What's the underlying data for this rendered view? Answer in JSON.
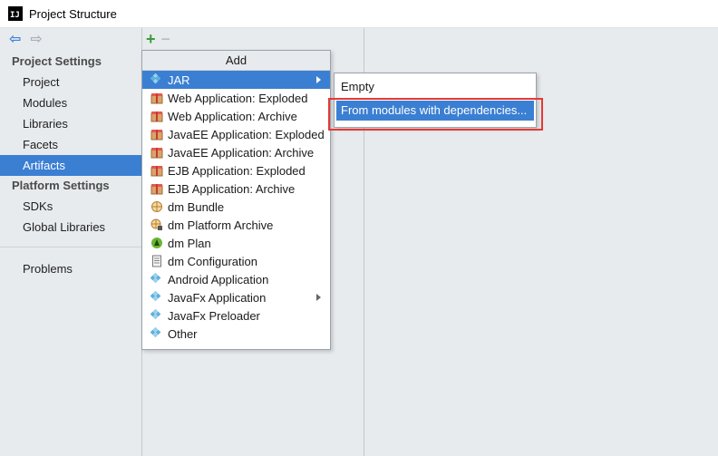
{
  "window": {
    "title": "Project Structure",
    "app_icon_text": "IJ"
  },
  "nav": {
    "back_icon": "arrow-left-icon",
    "forward_icon": "arrow-right-icon"
  },
  "sidebar": {
    "project_settings": {
      "label": "Project Settings",
      "items": [
        "Project",
        "Modules",
        "Libraries",
        "Facets",
        "Artifacts"
      ],
      "selected": "Artifacts"
    },
    "platform_settings": {
      "label": "Platform Settings",
      "items": [
        "SDKs",
        "Global Libraries"
      ]
    },
    "problems": "Problems"
  },
  "toolbar": {
    "add_symbol": "+",
    "remove_symbol": "−"
  },
  "add_menu": {
    "header": "Add",
    "items": [
      {
        "label": "JAR",
        "icon": "artifact-diamond-icon",
        "submenu": true,
        "highlighted": true
      },
      {
        "label": "Web Application: Exploded",
        "icon": "package-icon"
      },
      {
        "label": "Web Application: Archive",
        "icon": "package-icon"
      },
      {
        "label": "JavaEE Application: Exploded",
        "icon": "package-icon"
      },
      {
        "label": "JavaEE Application: Archive",
        "icon": "package-icon"
      },
      {
        "label": "EJB Application: Exploded",
        "icon": "package-icon"
      },
      {
        "label": "EJB Application: Archive",
        "icon": "package-icon"
      },
      {
        "label": "dm Bundle",
        "icon": "bundle-icon"
      },
      {
        "label": "dm Platform Archive",
        "icon": "bundle-lock-icon"
      },
      {
        "label": "dm Plan",
        "icon": "plan-icon"
      },
      {
        "label": "dm Configuration",
        "icon": "document-icon"
      },
      {
        "label": "Android Application",
        "icon": "artifact-diamond-icon"
      },
      {
        "label": "JavaFx Application",
        "icon": "artifact-diamond-icon",
        "submenu": true
      },
      {
        "label": "JavaFx Preloader",
        "icon": "artifact-diamond-icon"
      },
      {
        "label": "Other",
        "icon": "artifact-diamond-icon"
      }
    ]
  },
  "jar_submenu": {
    "items": [
      {
        "label": "Empty"
      },
      {
        "label": "From modules with dependencies...",
        "highlighted": true
      }
    ]
  },
  "colors": {
    "selection": "#3b7fd3",
    "panel_bg": "#e8ebee",
    "annotation_red": "#e53935",
    "add_green": "#3a9b3a"
  }
}
